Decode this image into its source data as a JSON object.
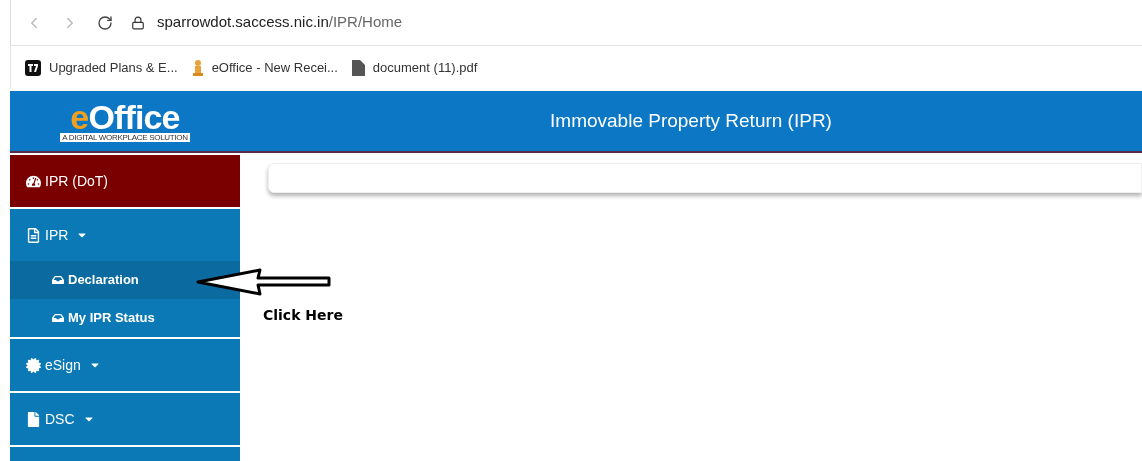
{
  "browser": {
    "url": {
      "host": "sparrowdot.saccess.nic.in",
      "path": "/IPR/Home"
    },
    "bookmarks": [
      {
        "kind": "app",
        "label": "Upgraded Plans & E..."
      },
      {
        "kind": "emblem",
        "label": "eOffice - New Recei..."
      },
      {
        "kind": "file",
        "label": "document (11).pdf"
      }
    ]
  },
  "header": {
    "logo": {
      "name": "eOffice",
      "tagline": "A DIGITAL WORKPLACE SOLUTION"
    },
    "title": "Immovable Property Return (IPR)"
  },
  "sidebar": {
    "items": [
      {
        "kind": "dashboard",
        "label": "IPR (DoT)",
        "selected": true
      },
      {
        "kind": "document",
        "label": "IPR",
        "selected": false,
        "has_menu": true,
        "expanded": true,
        "children": [
          {
            "label": "Declaration",
            "selected": true
          },
          {
            "label": "My IPR Status",
            "selected": false
          }
        ]
      },
      {
        "kind": "certificate",
        "label": "eSign",
        "selected": false,
        "has_menu": true
      },
      {
        "kind": "file",
        "label": "DSC",
        "selected": false,
        "has_menu": true
      }
    ]
  },
  "annotation": {
    "text": "Click Here"
  }
}
